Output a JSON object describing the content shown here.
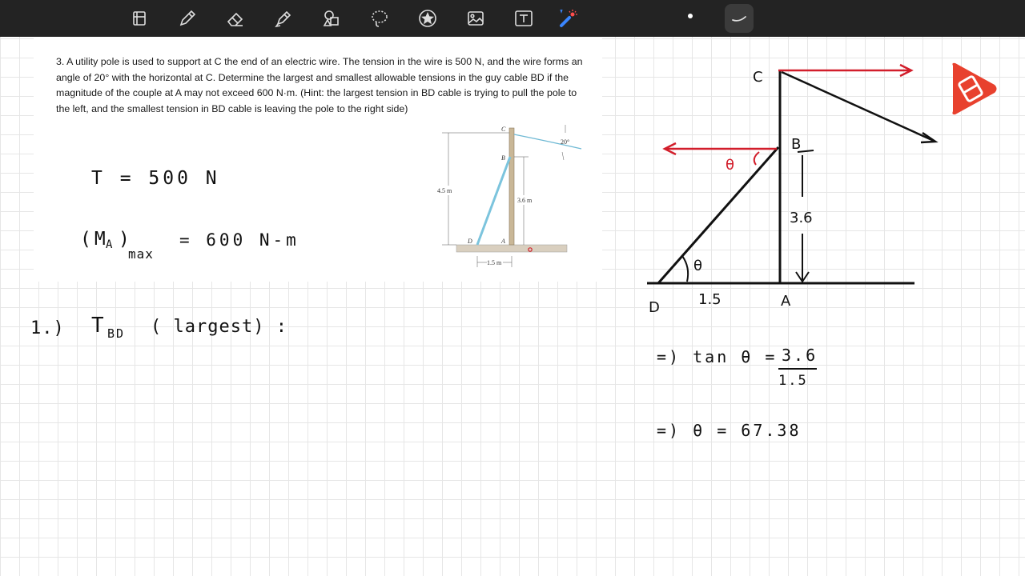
{
  "problem": {
    "text": "3. A utility pole is used to support at C the end of an electric wire. The tension in the wire is 500 N, and the wire forms an angle of 20° with the horizontal at C. Determine the largest and smallest allowable tensions in the guy cable BD if the magnitude of the couple at A may not exceed 600 N·m. (Hint: the largest tension in BD cable is trying to pull the pole to the left, and the smallest tension in BD cable is leaving the pole to the right side)"
  },
  "figure": {
    "label_c": "C",
    "label_b": "B",
    "label_d": "D",
    "label_a": "A",
    "angle": "20°",
    "height_total": "4.5 m",
    "height_b": "3.6 m",
    "width_base": "1.5 m"
  },
  "notes": {
    "tension": "T = 500 N",
    "moment_left": "(M",
    "moment_sub": "A",
    "moment_close": ")",
    "moment_max": "max",
    "moment_value": "= 600 N-m",
    "step_number": "1.)",
    "step_t": "T",
    "step_sub": "BD",
    "step_text": "( largest) :"
  },
  "sketch": {
    "label_c": "C",
    "label_b": "B",
    "label_d": "D",
    "label_a": "A",
    "label_theta_top": "θ",
    "label_theta_bottom": "θ",
    "height": "3.6",
    "base": "1.5",
    "eq1_lhs": "=) tan θ =",
    "eq1_num": "3.6",
    "eq1_den": "1.5",
    "eq2": "=) θ = 67.38"
  },
  "colors": {
    "toolbar": "#232323",
    "ink_red": "#d21e2b",
    "cable": "#7cc4dd",
    "logo": "#e8412e"
  }
}
